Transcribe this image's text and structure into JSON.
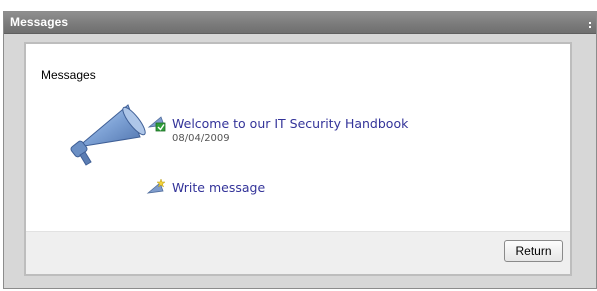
{
  "window": {
    "title": "Messages"
  },
  "panel": {
    "heading": "Messages",
    "message": {
      "title": "Welcome to our IT Security Handbook",
      "date": "08/04/2009"
    },
    "write_label": "Write message"
  },
  "footer": {
    "return_label": "Return"
  },
  "icons": {
    "megaphone": "megaphone-icon",
    "message": "megaphone-new-icon",
    "write": "megaphone-write-icon"
  },
  "colors": {
    "titlebar": "#7a7a7a",
    "link": "#333399",
    "megaphone": "#6b8fc4"
  }
}
